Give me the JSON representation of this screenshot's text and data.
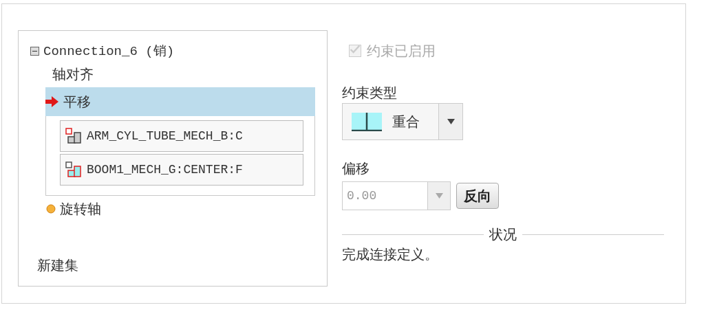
{
  "tree": {
    "label": "Connection_6 (销)",
    "expanded": true,
    "children": [
      {
        "label": "轴对齐",
        "selected": false,
        "kind": "plain"
      },
      {
        "label": "平移",
        "selected": true,
        "kind": "arrow",
        "references": [
          "ARM_CYL_TUBE_MECH_B:C",
          "BOOM1_MECH_G:CENTER:F"
        ]
      },
      {
        "label": "旋转轴",
        "selected": false,
        "kind": "dot"
      }
    ]
  },
  "new_set": "新建集",
  "enabled_checkbox": {
    "label": "约束已启用",
    "checked": true,
    "disabled": true
  },
  "constraint_type": {
    "label": "约束类型",
    "value": "重合"
  },
  "offset": {
    "label": "偏移",
    "value": "0.00",
    "disabled": true
  },
  "flip_button": "反向",
  "status": {
    "title": "状况",
    "message": "完成连接定义。"
  }
}
